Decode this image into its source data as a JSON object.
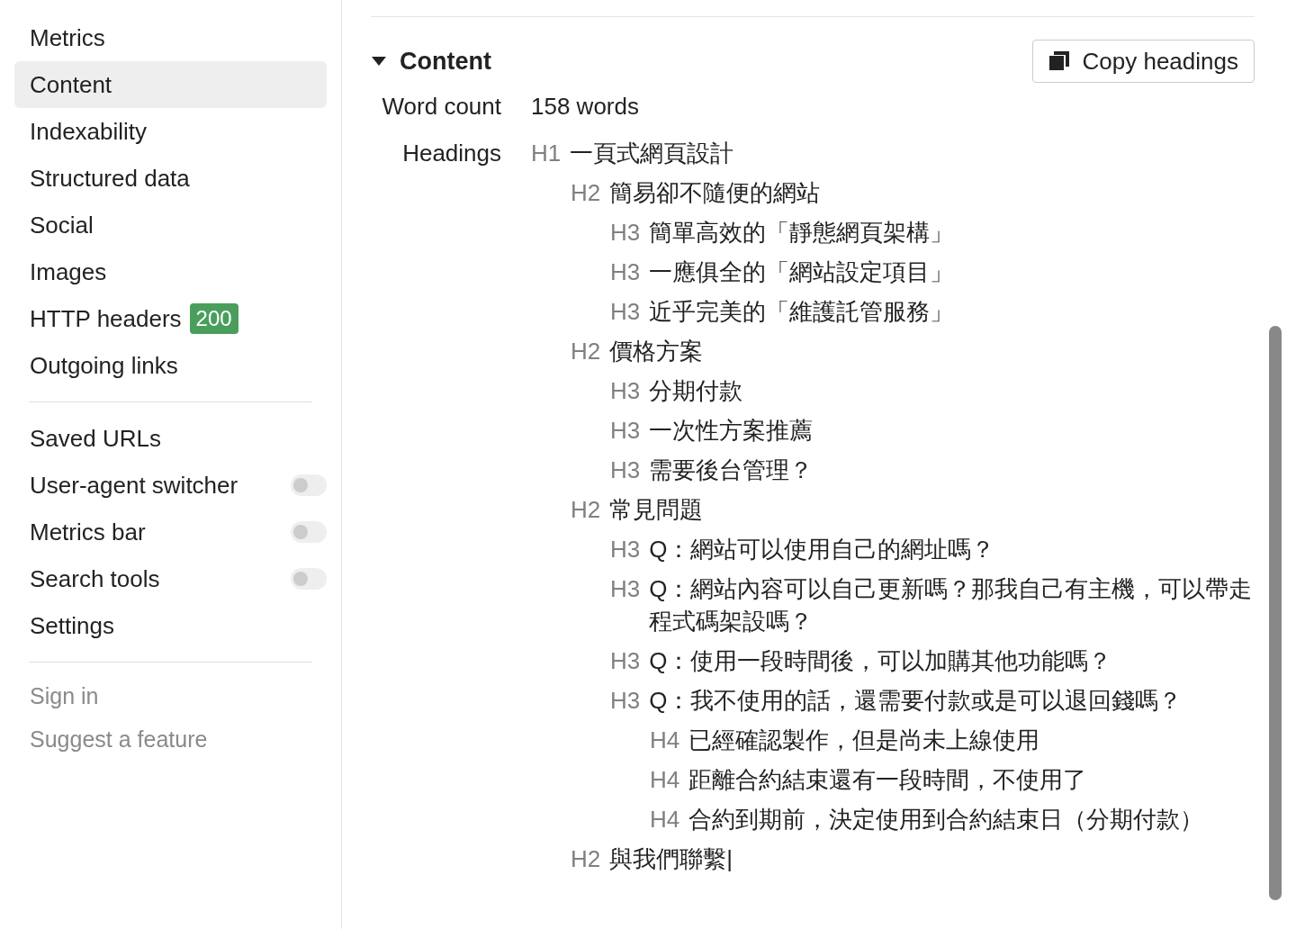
{
  "sidebar": {
    "nav": [
      {
        "label": "Metrics",
        "selected": false
      },
      {
        "label": "Content",
        "selected": true
      },
      {
        "label": "Indexability",
        "selected": false
      },
      {
        "label": "Structured data",
        "selected": false
      },
      {
        "label": "Social",
        "selected": false
      },
      {
        "label": "Images",
        "selected": false
      },
      {
        "label": "HTTP headers",
        "selected": false,
        "badge": "200"
      },
      {
        "label": "Outgoing links",
        "selected": false
      }
    ],
    "tools": [
      {
        "label": "Saved URLs",
        "kind": "link"
      },
      {
        "label": "User-agent switcher",
        "kind": "toggle",
        "on": false
      },
      {
        "label": "Metrics bar",
        "kind": "toggle",
        "on": false
      },
      {
        "label": "Search tools",
        "kind": "toggle",
        "on": false
      },
      {
        "label": "Settings",
        "kind": "link"
      }
    ],
    "footer_links": [
      "Sign in",
      "Suggest a feature"
    ]
  },
  "section": {
    "title": "Content",
    "expanded": true,
    "copy_button": "Copy headings",
    "word_count": {
      "label": "Word count",
      "value": "158 words"
    },
    "headings_label": "Headings",
    "headings": [
      {
        "tag": "H1",
        "text": "一頁式網頁設計",
        "children": [
          {
            "tag": "H2",
            "text": "簡易卻不隨便的網站",
            "children": [
              {
                "tag": "H3",
                "text": "簡單高效的「靜態網頁架構」"
              },
              {
                "tag": "H3",
                "text": "一應俱全的「網站設定項目」"
              },
              {
                "tag": "H3",
                "text": "近乎完美的「維護託管服務」"
              }
            ]
          },
          {
            "tag": "H2",
            "text": "價格方案",
            "children": [
              {
                "tag": "H3",
                "text": "分期付款"
              },
              {
                "tag": "H3",
                "text": "一次性方案推薦"
              },
              {
                "tag": "H3",
                "text": "需要後台管理？"
              }
            ]
          },
          {
            "tag": "H2",
            "text": "常見問題",
            "children": [
              {
                "tag": "H3",
                "text": "Q：網站可以使用自己的網址嗎？"
              },
              {
                "tag": "H3",
                "text": "Q：網站內容可以自己更新嗎？那我自己有主機，可以帶走程式碼架設嗎？"
              },
              {
                "tag": "H3",
                "text": "Q：使用一段時間後，可以加購其他功能嗎？"
              },
              {
                "tag": "H3",
                "text": "Q：我不使用的話，還需要付款或是可以退回錢嗎？",
                "children": [
                  {
                    "tag": "H4",
                    "text": "已經確認製作，但是尚未上線使用"
                  },
                  {
                    "tag": "H4",
                    "text": "距離合約結束還有一段時間，不使用了"
                  },
                  {
                    "tag": "H4",
                    "text": "合約到期前，決定使用到合約結束日（分期付款）"
                  }
                ]
              }
            ]
          },
          {
            "tag": "H2",
            "text": "與我們聯繫|"
          }
        ]
      }
    ]
  }
}
